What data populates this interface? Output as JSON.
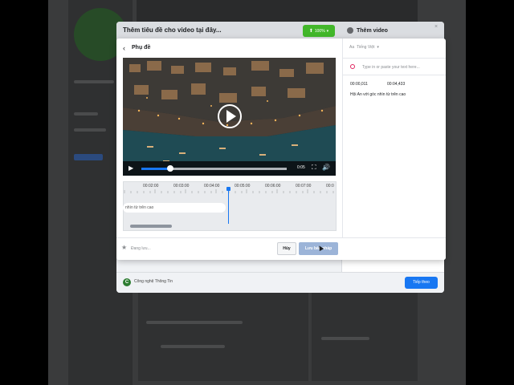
{
  "outer": {
    "title": "Thêm tiêu đề cho video tại đây...",
    "upload_progress": "100%",
    "right_title": "Thêm video",
    "close": "×",
    "page_name": "Công nghệ Thông Tin",
    "page_initial": "C",
    "next_label": "Tiếp theo"
  },
  "dialog": {
    "back": "‹",
    "title": "Phụ đề",
    "language": "Tiếng Việt",
    "input_placeholder": "Type in or paste your text here...",
    "caption_start": "00:00,011",
    "caption_end": "00:04,433",
    "caption_text": "Hội An với góc nhìn từ trên cao",
    "timeline_caption": "nhìn từ trên cao",
    "video_time": "0:05",
    "timeline_labels": [
      "00:02:00",
      "00:03:00",
      "00:04:00",
      "00:05:00",
      "00:06:00",
      "00:07:00",
      "00:0"
    ],
    "saving": "Đang lưu...",
    "cancel_label": "Hủy",
    "save_label": "Lưu bản nháp",
    "video_progress": 0.2
  }
}
